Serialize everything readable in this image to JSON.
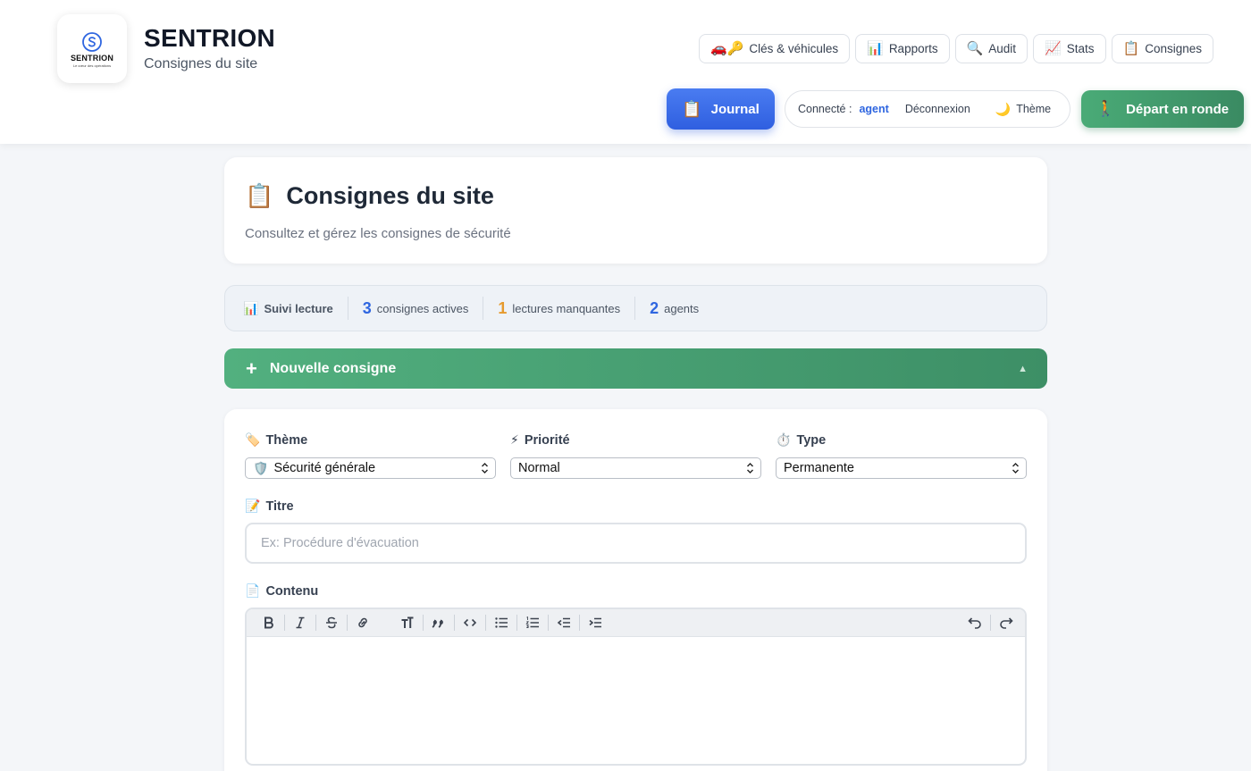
{
  "brand": {
    "logo_text": "SENTRION",
    "logo_tagline": "Le cœur des opérations",
    "title": "SENTRION",
    "subtitle": "Consignes du site"
  },
  "topnav": [
    {
      "icon": "🚗🔑",
      "label": "Clés & véhicules"
    },
    {
      "icon": "📊",
      "label": "Rapports"
    },
    {
      "icon": "🔍",
      "label": "Audit"
    },
    {
      "icon": "📈",
      "label": "Stats"
    },
    {
      "icon": "📋",
      "label": "Consignes"
    }
  ],
  "journal": {
    "icon": "📋",
    "label": "Journal"
  },
  "session": {
    "connected_label": "Connecté :",
    "user": "agent",
    "logout_label": "Déconnexion",
    "theme_icon": "🌙",
    "theme_label": "Thème"
  },
  "ronde": {
    "icon": "🚶",
    "label": "Départ en ronde"
  },
  "page": {
    "icon": "📋",
    "title": "Consignes du site",
    "description": "Consultez et gérez les consignes de sécurité"
  },
  "stats": {
    "head_icon": "📊",
    "head_label": "Suivi lecture",
    "active_count": "3",
    "active_label": "consignes actives",
    "missing_count": "1",
    "missing_label": "lectures manquantes",
    "agents_count": "2",
    "agents_label": "agents",
    "colors": {
      "blue": "#2f66e0",
      "orange": "#e69a2e"
    }
  },
  "new_consigne": {
    "plus": "+",
    "label": "Nouvelle consigne",
    "caret": "▲"
  },
  "form": {
    "theme": {
      "icon": "🏷️",
      "label": "Thème",
      "value_icon": "🛡️",
      "value": "Sécurité générale"
    },
    "priority": {
      "icon": "⚡",
      "label": "Priorité",
      "value": "Normal"
    },
    "type": {
      "icon": "⏱️",
      "label": "Type",
      "value": "Permanente"
    },
    "title": {
      "icon": "📝",
      "label": "Titre",
      "placeholder": "Ex: Procédure d'évacuation",
      "value": ""
    },
    "content": {
      "icon": "📄",
      "label": "Contenu"
    }
  }
}
